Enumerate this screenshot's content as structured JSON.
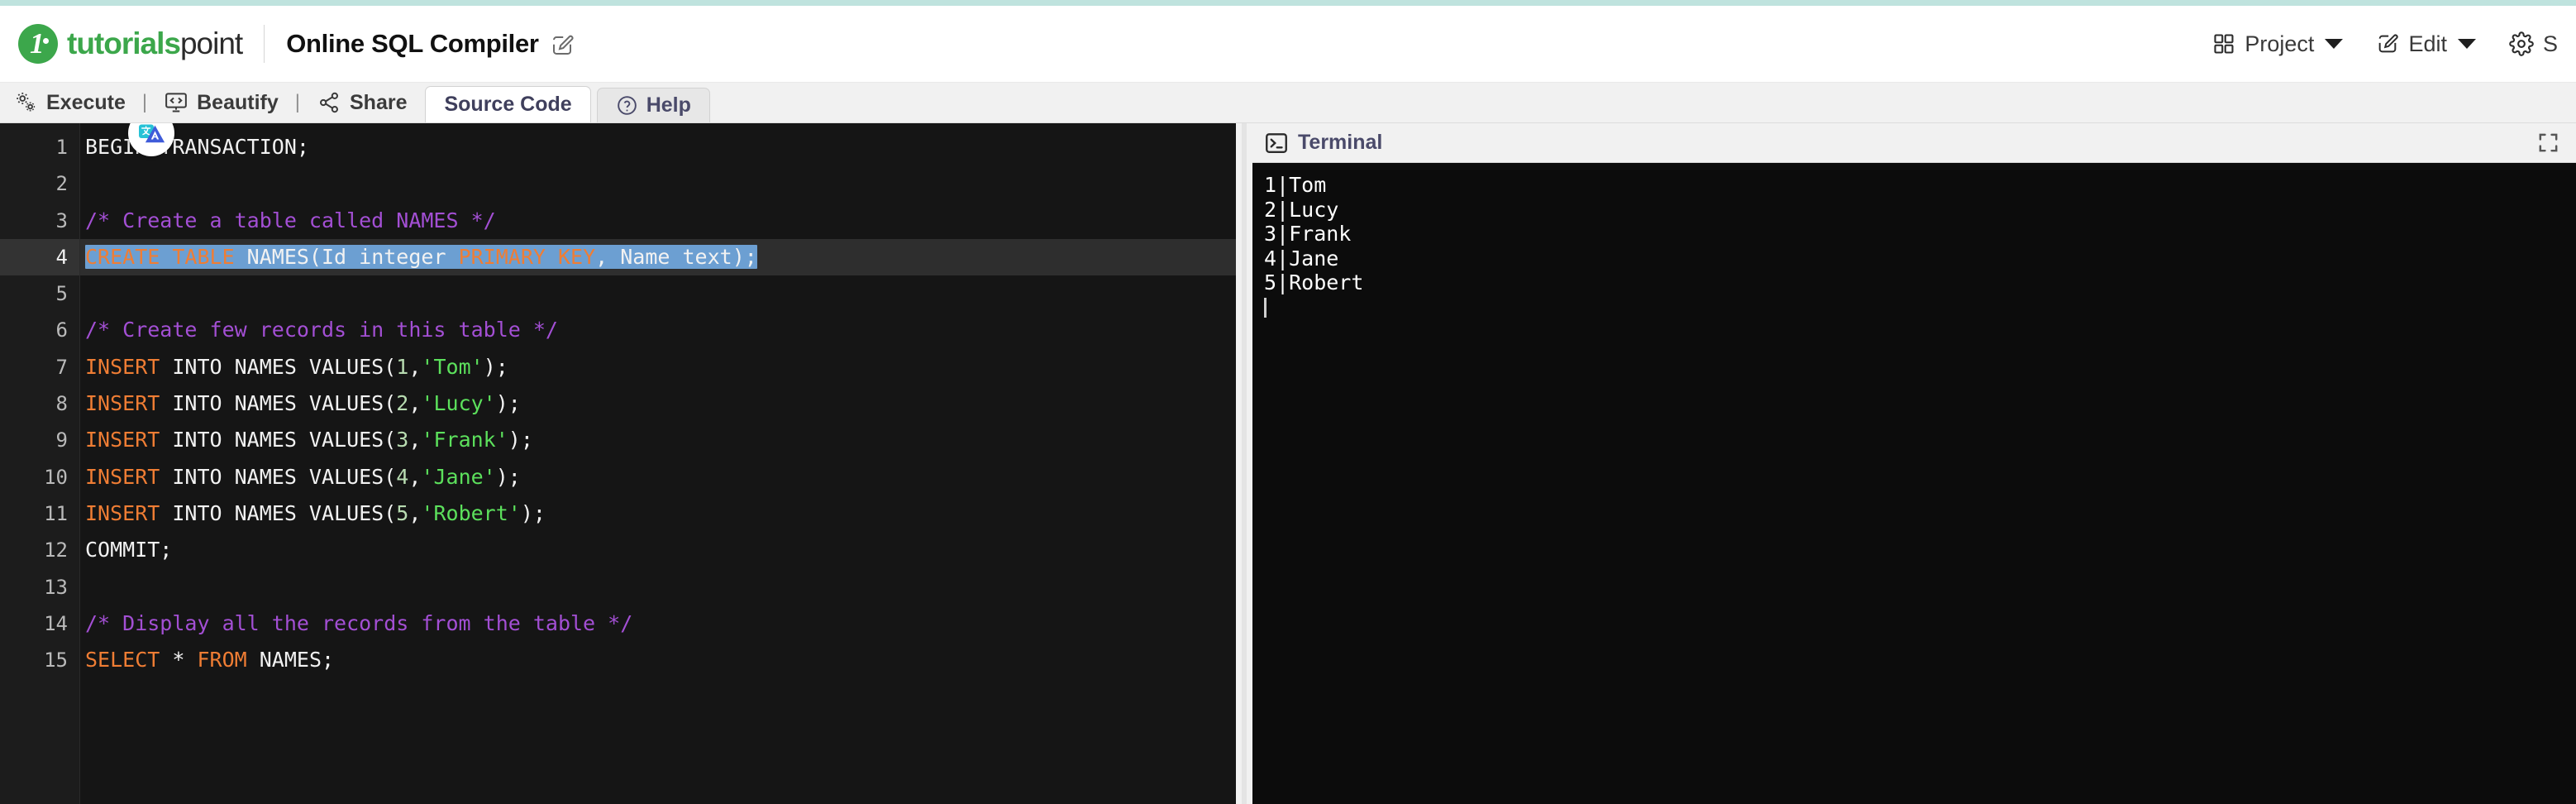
{
  "brand": {
    "logo_text_bold": "tutorials",
    "logo_text_light": "point",
    "logo_icon": "tutorialspoint-logo-icon",
    "accent_green": "#3ca74b",
    "top_strip_color": "#bfe3de"
  },
  "header": {
    "page_title": "Online SQL Compiler",
    "title_edit_icon": "pencil-square-icon",
    "menu": [
      {
        "label": "Project",
        "icon": "grid-icon",
        "has_caret": true
      },
      {
        "label": "Edit",
        "icon": "pencil-square-icon",
        "has_caret": true
      },
      {
        "label": "S",
        "icon": "gear-icon",
        "has_caret": false
      }
    ]
  },
  "toolbar": {
    "execute_label": "Execute",
    "execute_icon": "gears-icon",
    "beautify_label": "Beautify",
    "beautify_icon": "code-monitor-icon",
    "share_label": "Share",
    "share_icon": "share-nodes-icon",
    "separator": "|",
    "tabs": [
      {
        "label": "Source Code",
        "active": true,
        "icon": null
      },
      {
        "label": "Help",
        "active": false,
        "icon": "question-circle-icon"
      }
    ]
  },
  "editor": {
    "active_line": 4,
    "selected_line": 4,
    "translate_badge_icon": "translate-icon",
    "line_numbers": [
      1,
      2,
      3,
      4,
      5,
      6,
      7,
      8,
      9,
      10,
      11,
      12,
      13,
      14,
      15
    ],
    "lines": [
      {
        "n": 1,
        "tokens": [
          {
            "t": "BEGIN TRANSACTION;",
            "c": "plain"
          }
        ]
      },
      {
        "n": 2,
        "tokens": []
      },
      {
        "n": 3,
        "tokens": [
          {
            "t": "/* Create a table called NAMES */",
            "c": "cm"
          }
        ]
      },
      {
        "n": 4,
        "selected": true,
        "tokens": [
          {
            "t": "CREATE TABLE",
            "c": "kw"
          },
          {
            "t": " NAMES(Id integer ",
            "c": "plain"
          },
          {
            "t": "PRIMARY KEY",
            "c": "kw"
          },
          {
            "t": ", Name text);",
            "c": "plain"
          }
        ]
      },
      {
        "n": 5,
        "tokens": []
      },
      {
        "n": 6,
        "tokens": [
          {
            "t": "/* Create few records in this table */",
            "c": "cm"
          }
        ]
      },
      {
        "n": 7,
        "tokens": [
          {
            "t": "INSERT",
            "c": "kw"
          },
          {
            "t": " INTO NAMES VALUES(",
            "c": "plain"
          },
          {
            "t": "1",
            "c": "num"
          },
          {
            "t": ",",
            "c": "plain"
          },
          {
            "t": "'Tom'",
            "c": "str"
          },
          {
            "t": ");",
            "c": "plain"
          }
        ]
      },
      {
        "n": 8,
        "tokens": [
          {
            "t": "INSERT",
            "c": "kw"
          },
          {
            "t": " INTO NAMES VALUES(",
            "c": "plain"
          },
          {
            "t": "2",
            "c": "num"
          },
          {
            "t": ",",
            "c": "plain"
          },
          {
            "t": "'Lucy'",
            "c": "str"
          },
          {
            "t": ");",
            "c": "plain"
          }
        ]
      },
      {
        "n": 9,
        "tokens": [
          {
            "t": "INSERT",
            "c": "kw"
          },
          {
            "t": " INTO NAMES VALUES(",
            "c": "plain"
          },
          {
            "t": "3",
            "c": "num"
          },
          {
            "t": ",",
            "c": "plain"
          },
          {
            "t": "'Frank'",
            "c": "str"
          },
          {
            "t": ");",
            "c": "plain"
          }
        ]
      },
      {
        "n": 10,
        "tokens": [
          {
            "t": "INSERT",
            "c": "kw"
          },
          {
            "t": " INTO NAMES VALUES(",
            "c": "plain"
          },
          {
            "t": "4",
            "c": "num"
          },
          {
            "t": ",",
            "c": "plain"
          },
          {
            "t": "'Jane'",
            "c": "str"
          },
          {
            "t": ");",
            "c": "plain"
          }
        ]
      },
      {
        "n": 11,
        "tokens": [
          {
            "t": "INSERT",
            "c": "kw"
          },
          {
            "t": " INTO NAMES VALUES(",
            "c": "plain"
          },
          {
            "t": "5",
            "c": "num"
          },
          {
            "t": ",",
            "c": "plain"
          },
          {
            "t": "'Robert'",
            "c": "str"
          },
          {
            "t": ");",
            "c": "plain"
          }
        ]
      },
      {
        "n": 12,
        "tokens": [
          {
            "t": "COMMIT;",
            "c": "plain"
          }
        ]
      },
      {
        "n": 13,
        "tokens": []
      },
      {
        "n": 14,
        "tokens": [
          {
            "t": "/* Display all the records from the table */",
            "c": "cm"
          }
        ]
      },
      {
        "n": 15,
        "tokens": [
          {
            "t": "SELECT",
            "c": "kw"
          },
          {
            "t": " * ",
            "c": "plain"
          },
          {
            "t": "FROM",
            "c": "kw"
          },
          {
            "t": " NAMES;",
            "c": "plain"
          }
        ]
      }
    ],
    "colors": {
      "background": "#151515",
      "gutter_background": "#1c1c1c",
      "active_line_background": "#2e2e2e",
      "selection": "#6c9fd2",
      "keyword": "#ef7d34",
      "comment": "#a34fd4",
      "string": "#5ce05c",
      "number": "#b8dcb1",
      "text": "#f2f2f2"
    }
  },
  "terminal": {
    "title": "Terminal",
    "title_icon": "terminal-prompt-icon",
    "fullscreen_icon": "fullscreen-expand-icon",
    "output": [
      "1|Tom",
      "2|Lucy",
      "3|Frank",
      "4|Jane",
      "5|Robert"
    ],
    "cursor_visible": true,
    "background": "#0c0c0c",
    "text_color": "#ffffff"
  }
}
